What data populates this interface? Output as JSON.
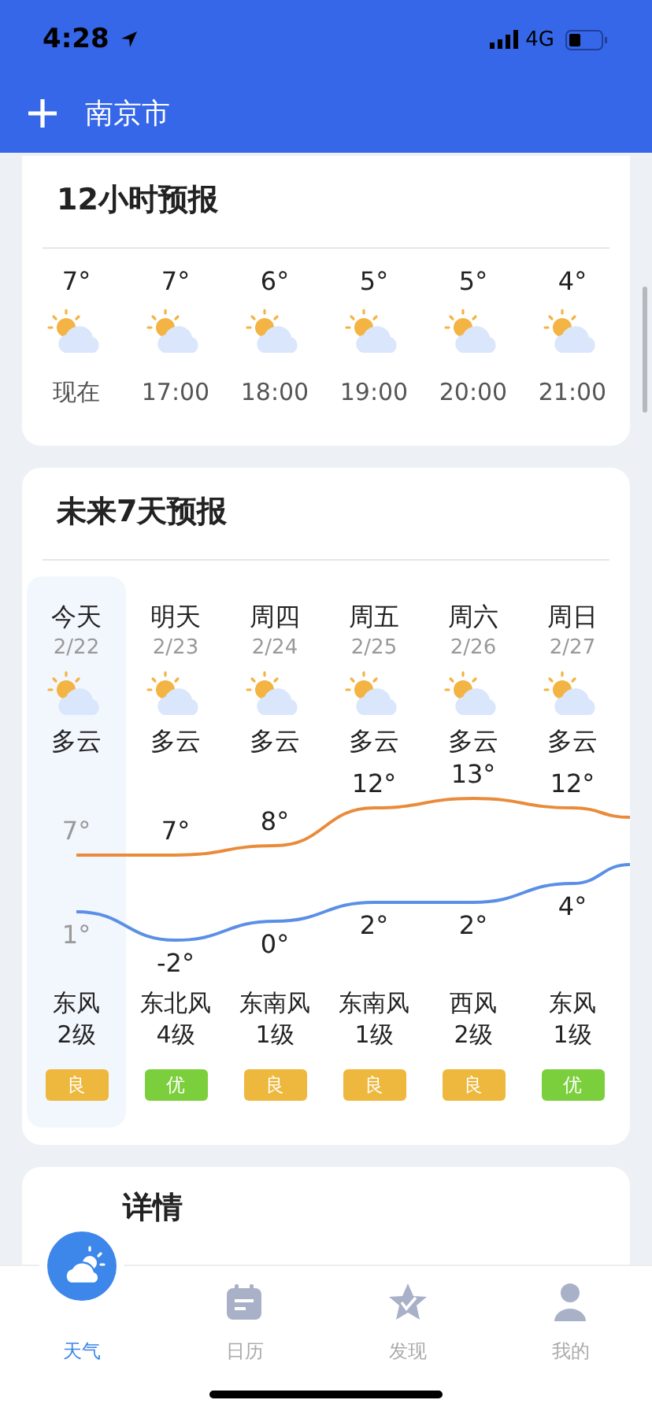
{
  "status_bar": {
    "time": "4:28",
    "network": "4G"
  },
  "header": {
    "city": "南京市"
  },
  "hourly": {
    "title": "12小时预报",
    "hours": [
      {
        "temp": "7°",
        "time": "现在"
      },
      {
        "temp": "7°",
        "time": "17:00"
      },
      {
        "temp": "6°",
        "time": "18:00"
      },
      {
        "temp": "5°",
        "time": "19:00"
      },
      {
        "temp": "5°",
        "time": "20:00"
      },
      {
        "temp": "4°",
        "time": "21:00"
      }
    ]
  },
  "daily": {
    "title": "未来7天预报",
    "days": [
      {
        "day": "今天",
        "date": "2/22",
        "condition": "多云",
        "high": "7°",
        "low": "1°",
        "wind": "东风",
        "wind_level": "2级",
        "aqi": {
          "text": "良",
          "color": "#edb83d"
        },
        "selected": true
      },
      {
        "day": "明天",
        "date": "2/23",
        "condition": "多云",
        "high": "7°",
        "low": "-2°",
        "wind": "东北风",
        "wind_level": "4级",
        "aqi": {
          "text": "优",
          "color": "#7ccf3c"
        },
        "selected": false
      },
      {
        "day": "周四",
        "date": "2/24",
        "condition": "多云",
        "high": "8°",
        "low": "0°",
        "wind": "东南风",
        "wind_level": "1级",
        "aqi": {
          "text": "良",
          "color": "#edb83d"
        },
        "selected": false
      },
      {
        "day": "周五",
        "date": "2/25",
        "condition": "多云",
        "high": "12°",
        "low": "2°",
        "wind": "东南风",
        "wind_level": "1级",
        "aqi": {
          "text": "良",
          "color": "#edb83d"
        },
        "selected": false
      },
      {
        "day": "周六",
        "date": "2/26",
        "condition": "多云",
        "high": "13°",
        "low": "2°",
        "wind": "西风",
        "wind_level": "2级",
        "aqi": {
          "text": "良",
          "color": "#edb83d"
        },
        "selected": false
      },
      {
        "day": "周日",
        "date": "2/27",
        "condition": "多云",
        "high": "12°",
        "low": "4°",
        "wind": "东风",
        "wind_level": "1级",
        "aqi": {
          "text": "优",
          "color": "#7ccf3c"
        },
        "selected": false
      }
    ]
  },
  "next_card": {
    "title": "详情"
  },
  "tab_bar": {
    "tabs": [
      {
        "label": "天气",
        "selected": true
      },
      {
        "label": "日历",
        "selected": false
      },
      {
        "label": "发现",
        "selected": false
      },
      {
        "label": "我的",
        "selected": false
      }
    ]
  }
}
